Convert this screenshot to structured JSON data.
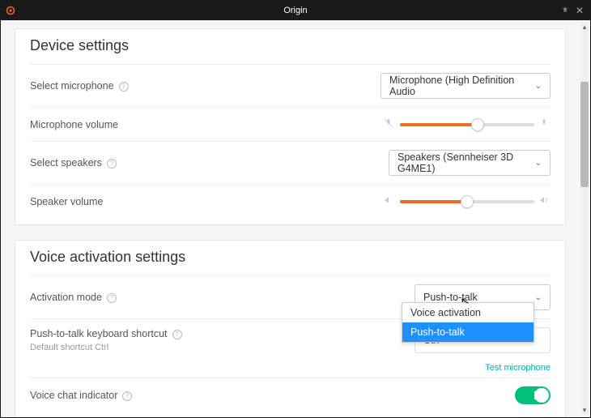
{
  "titlebar": {
    "title": "Origin"
  },
  "device": {
    "heading": "Device settings",
    "select_mic_label": "Select microphone",
    "mic_selected": "Microphone (High Definition Audio",
    "mic_volume_label": "Microphone volume",
    "mic_volume_pct": 58,
    "select_spk_label": "Select speakers",
    "spk_selected": "Speakers (Sennheiser 3D G4ME1)",
    "spk_volume_label": "Speaker volume",
    "spk_volume_pct": 50
  },
  "voice": {
    "heading": "Voice activation settings",
    "activation_label": "Activation mode",
    "activation_selected": "Push-to-talk",
    "activation_options": {
      "a": "Voice activation",
      "b": "Push-to-talk"
    },
    "ptt_label": "Push-to-talk keyboard shortcut",
    "ptt_sub": "Default shortcut Ctrl",
    "ptt_value": "Ctrl",
    "test_link": "Test microphone",
    "indicator_label": "Voice chat indicator",
    "indicator_on": true
  }
}
